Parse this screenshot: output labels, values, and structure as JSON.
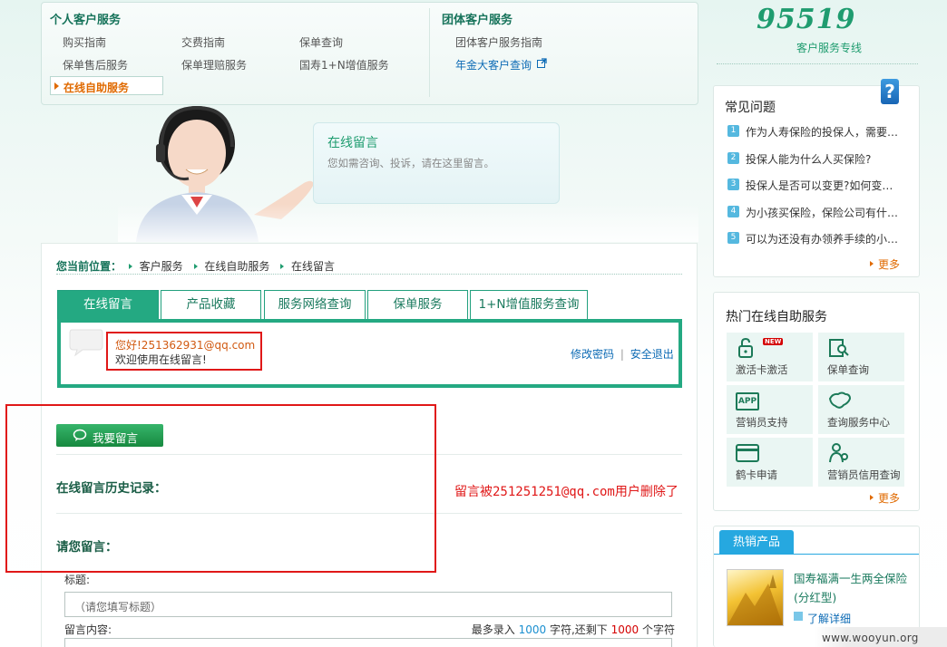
{
  "topnav": {
    "personal_heading": "个人客户服务",
    "personal_links": [
      "购买指南",
      "交费指南",
      "保单查询",
      "保单售后服务",
      "保单理赔服务",
      "国寿1+N增值服务"
    ],
    "active_link": "在线自助服务",
    "group_heading": "团体客户服务",
    "group_links": [
      "团体客户服务指南",
      "年金大客户查询"
    ]
  },
  "logo": {
    "number": "95519",
    "subtitle": "客户服务专线"
  },
  "banner": {
    "title": "在线留言",
    "subtitle": "您如需咨询、投诉，请在这里留言。"
  },
  "breadcrumb": {
    "label": "您当前位置：",
    "items": [
      "客户服务",
      "在线自助服务",
      "在线留言"
    ]
  },
  "tabs": [
    "在线留言",
    "产品收藏",
    "服务网络查询",
    "保单服务",
    "1+N增值服务查询"
  ],
  "user_panel": {
    "greeting": "您好!251362931@qq.com",
    "welcome": "欢迎使用在线留言!",
    "change_password": "修改密码",
    "separator": "|",
    "logout": "安全退出"
  },
  "message_section": {
    "leave_message_button": "我要留言",
    "history_title": "在线留言历史记录：",
    "leave_title": "请您留言：",
    "title_label": "标题:",
    "title_placeholder": "（请您填写标题）",
    "content_label": "留言内容:",
    "limit_prefix": "最多录入",
    "limit_max": "1000",
    "limit_mid": "字符,还剩下",
    "limit_remain": "1000",
    "limit_suffix": "个字符"
  },
  "annotation": "留言被251251251@qq.com用户删除了",
  "faq": {
    "title": "常见问题",
    "items": [
      {
        "num": "1",
        "text": "作为人寿保险的投保人，需要…"
      },
      {
        "num": "2",
        "text": "投保人能为什么人买保险?"
      },
      {
        "num": "3",
        "text": "投保人是否可以变更?如何变…"
      },
      {
        "num": "4",
        "text": "为小孩买保险，保险公司有什…"
      },
      {
        "num": "5",
        "text": "可以为还没有办领养手续的小…"
      }
    ],
    "more": "更多"
  },
  "hot_services": {
    "title": "热门在线自助服务",
    "new_badge": "NEW",
    "app_badge": "APP",
    "items": [
      "激活卡激活",
      "保单查询",
      "营销员支持",
      "查询服务中心",
      "鹤卡申请",
      "营销员信用查询"
    ],
    "more": "更多"
  },
  "hot_products": {
    "tab": "热销产品",
    "product_name": "国寿福满一生两全保险(分红型)",
    "detail_link": "了解详细"
  },
  "watermark": "www.wooyun.org",
  "colors": {
    "brand_green": "#24a982",
    "alert_red": "#e01818",
    "link_blue": "#0d6bb5",
    "accent_orange": "#e06a00"
  }
}
